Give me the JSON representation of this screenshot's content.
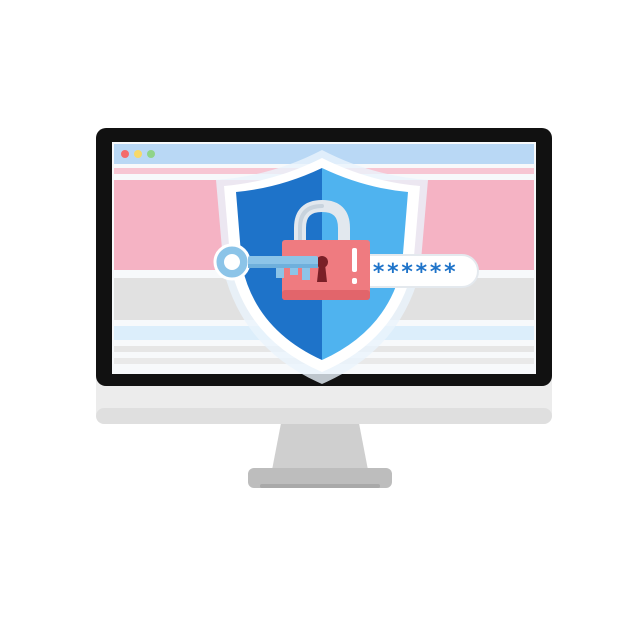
{
  "illustration": {
    "subject": "computer-monitor-security",
    "icons": [
      "monitor-icon",
      "shield-icon",
      "padlock-icon",
      "key-icon",
      "password-field-icon"
    ]
  },
  "password_field": {
    "masked_value": "******"
  },
  "colors": {
    "monitor_bezel": "#111111",
    "monitor_chin": "#ececec",
    "stand": "#c9c9c9",
    "browser_bar": "#b9d8f5",
    "dot_red": "#f36b6b",
    "dot_yellow": "#f7d96a",
    "dot_green": "#8fd48a",
    "banner_pink": "#f5b3c4",
    "band_gray": "#e1e1e1",
    "band_light_blue": "#dceefb",
    "shield_outer": "#ffffff",
    "shield_left": "#1e73c9",
    "shield_right": "#4fb3ef",
    "lock_body": "#ef7b80",
    "lock_shackle": "#e2e8ee",
    "key": "#8cc4e8",
    "password_text": "#1e73c9"
  }
}
